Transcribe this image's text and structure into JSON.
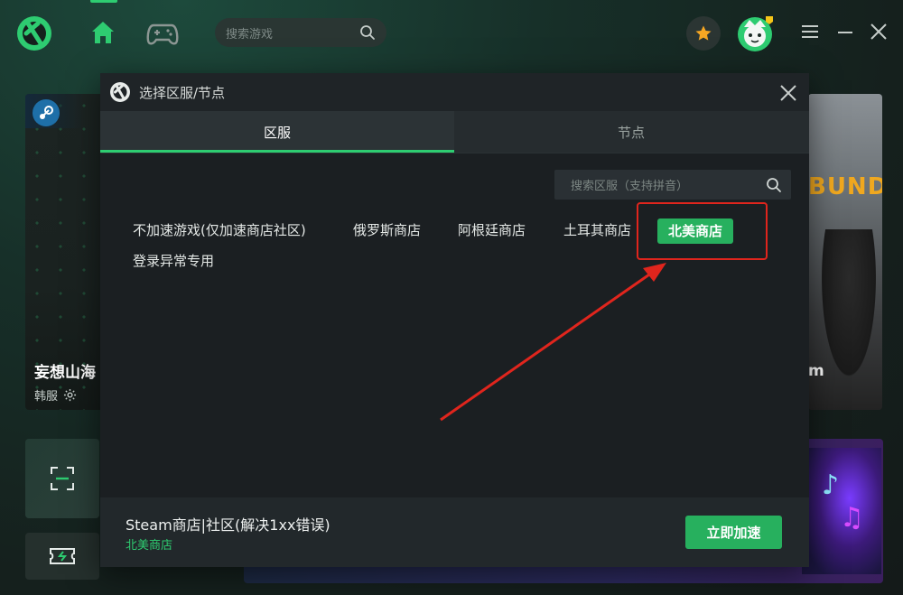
{
  "header": {
    "search_placeholder": "搜索游戏"
  },
  "cards": {
    "left_title": "妄想山海",
    "left_region": "韩服",
    "right_label": "m",
    "right_logo_text": "BUNDS"
  },
  "dialog": {
    "title": "选择区服/节点",
    "tabs": [
      {
        "label": "区服",
        "active": true
      },
      {
        "label": "节点",
        "active": false
      }
    ],
    "search_placeholder": "搜索区服（支持拼音）",
    "regions": [
      {
        "label": "不加速游戏(仅加速商店社区)",
        "selected": false
      },
      {
        "label": "俄罗斯商店",
        "selected": false
      },
      {
        "label": "阿根廷商店",
        "selected": false
      },
      {
        "label": "土耳其商店",
        "selected": false
      },
      {
        "label": "北美商店",
        "selected": true
      },
      {
        "label": "登录异常专用",
        "selected": false
      }
    ],
    "footer": {
      "title": "Steam商店|社区(解决1xx错误)",
      "subtitle": "北美商店",
      "accelerate_label": "立即加速"
    }
  },
  "colors": {
    "accent": "#2ecc71",
    "selected_bg": "#27b05e",
    "annotation_red": "#e0251d",
    "dialog_bg": "#1b1f22"
  },
  "icons": [
    "app-logo-icon",
    "home-icon",
    "gamepad-icon",
    "search-icon",
    "star-icon",
    "avatar-icon",
    "menu-icon",
    "minimize-icon",
    "close-icon",
    "steam-icon",
    "gear-icon",
    "scan-icon",
    "ticket-icon"
  ]
}
